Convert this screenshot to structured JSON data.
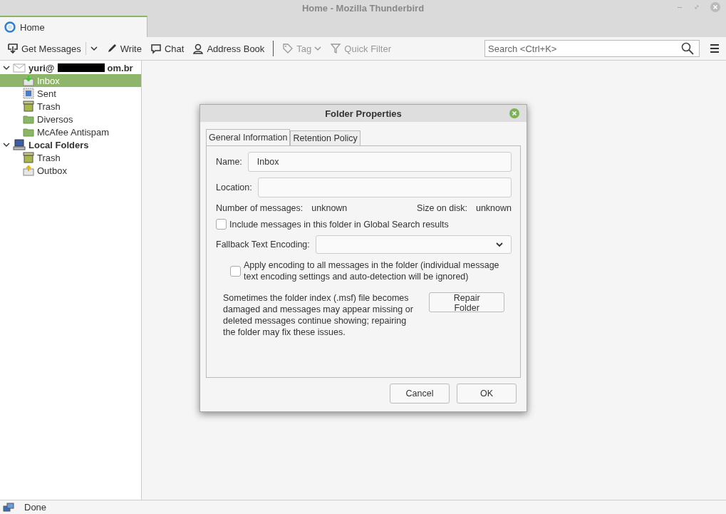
{
  "window": {
    "title": "Home - Mozilla Thunderbird"
  },
  "tabs": [
    {
      "label": "Home",
      "selected": true
    }
  ],
  "toolbar": [
    {
      "kind": "get",
      "label": "Get Messages",
      "disabled": false
    },
    {
      "kind": "write",
      "label": "Write",
      "disabled": false
    },
    {
      "kind": "chat",
      "label": "Chat",
      "disabled": false
    },
    {
      "kind": "address",
      "label": "Address Book",
      "disabled": false
    },
    {
      "kind": "tag",
      "label": "Tag",
      "disabled": true
    },
    {
      "kind": "filter",
      "label": "Quick Filter",
      "disabled": true
    }
  ],
  "search": {
    "placeholder": "Search <Ctrl+K>"
  },
  "folders": [
    {
      "kind": "account",
      "label_start": "yuri@",
      "label_end": "om.br",
      "redacted": true,
      "expanded": true,
      "selected": false,
      "children": [
        {
          "kind": "inbox",
          "label": "Inbox",
          "selected": true
        },
        {
          "kind": "sent",
          "label": "Sent",
          "selected": false
        },
        {
          "kind": "trash",
          "label": "Trash",
          "selected": false
        },
        {
          "kind": "folder",
          "label": "Diversos",
          "selected": false
        },
        {
          "kind": "folder",
          "label": "McAfee Antispam",
          "selected": false
        }
      ]
    },
    {
      "kind": "local",
      "label_start": "Local Folders",
      "expanded": true,
      "selected": false,
      "children": [
        {
          "kind": "trash",
          "label": "Trash",
          "selected": false
        },
        {
          "kind": "outbox",
          "label": "Outbox",
          "selected": false
        }
      ]
    }
  ],
  "status_bar": {
    "text": "Done"
  },
  "dialog": {
    "title": "Folder Properties",
    "tabs": [
      {
        "label": "General Information",
        "selected": true
      },
      {
        "label": "Retention Policy",
        "selected": false
      }
    ],
    "name": {
      "label": "Name:",
      "value": "Inbox"
    },
    "location": {
      "label": "Location:"
    },
    "stats": [
      {
        "label": "Number of messages:",
        "value": "unknown"
      },
      {
        "label": "Size on disk:",
        "value": "unknown"
      }
    ],
    "global_search": {
      "label": "Include messages in this folder in Global Search results",
      "checked": false
    },
    "encoding": {
      "label": "Fallback Text Encoding:"
    },
    "apply_encoding": {
      "label": "Apply encoding to all messages in the folder (individual message text encoding settings and auto-detection will be ignored)",
      "checked": false
    },
    "repair_text": "Sometimes the folder index (.msf) file becomes damaged and messages may appear missing or deleted messages continue showing; repairing the folder may fix these issues.",
    "repair_button": {
      "label": "Repair Folder"
    },
    "buttons": [
      "Cancel",
      "OK"
    ]
  }
}
